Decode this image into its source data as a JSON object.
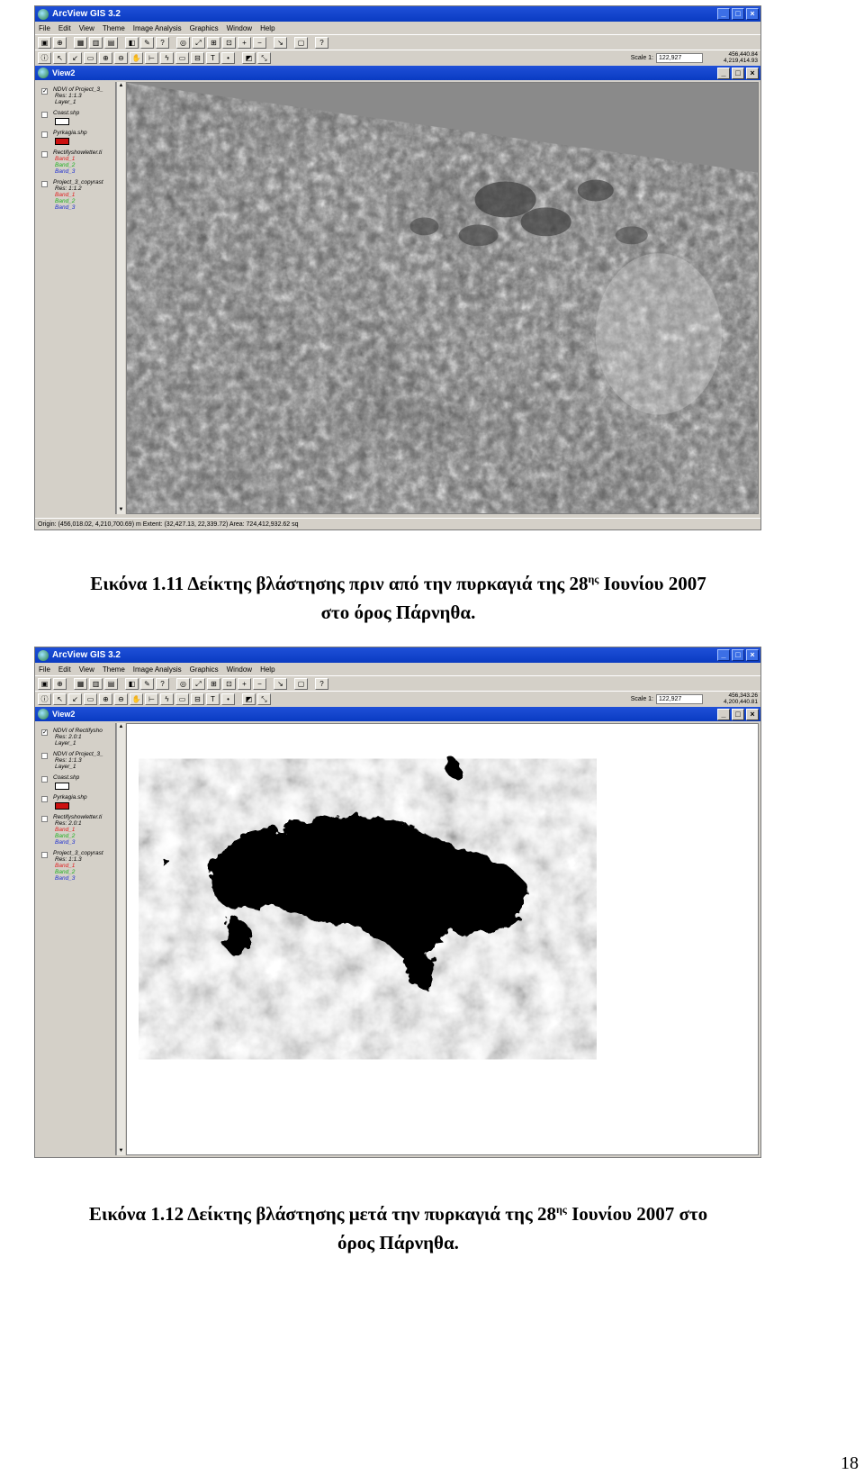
{
  "app_title": "ArcView GIS 3.2",
  "menu": [
    "File",
    "Edit",
    "View",
    "Theme",
    "Image Analysis",
    "Graphics",
    "Window",
    "Help"
  ],
  "toolbar_row1": [
    "save-icon",
    "add-theme-icon",
    "table-icon",
    "chart-icon",
    "layout-icon",
    "theme-props-icon",
    "edit-legend-icon",
    "query-icon",
    "locate-icon",
    "zoom-full-icon",
    "zoom-theme-icon",
    "zoom-select-icon",
    "zoom-in-icon",
    "zoom-out-icon",
    "select-feature-icon",
    "clear-select-icon",
    "help-icon"
  ],
  "toolbar_row2": [
    "info-icon",
    "pointer-icon",
    "vertex-icon",
    "select-icon",
    "zoom-in-tool-icon",
    "zoom-out-tool-icon",
    "pan-icon",
    "measure-icon",
    "hotlink-icon",
    "area-icon",
    "label-icon",
    "text-icon",
    "draw-icon",
    "image-tool-1-icon",
    "image-tool-2-icon"
  ],
  "scale_label": "Scale 1:",
  "view_title": "View2",
  "figure1": {
    "scale_value": "122,927",
    "coords": [
      "456,440.84",
      "4,219,414.93"
    ],
    "toc": [
      {
        "checked": true,
        "name": "NDVI of Project_3_",
        "lines": [
          "Res: 1:1.3",
          "Layer_1"
        ]
      },
      {
        "checked": false,
        "name": "Coast.shp",
        "swatch": "#ffffff"
      },
      {
        "checked": false,
        "name": "Pyrkagia.shp",
        "swatch": "#cc1010"
      },
      {
        "checked": false,
        "name": "Rectifyshowletter.ti",
        "lines": [
          "Band_1",
          "Band_2",
          "Band_3"
        ]
      },
      {
        "checked": false,
        "name": "Project_3_copyrast",
        "lines": [
          "Res: 1:1.2",
          "Band_1",
          "Band_2",
          "Band_3"
        ]
      }
    ],
    "status_text": "Origin: (456,018.02, 4,210,700.69) m  Extent: (32,427.13, 22,339.72)   Area: 724,412,932.62 sq",
    "caption_before": "Εικόνα 1.11 Δείκτης βλάστησης πριν από την πυρκαγιά της 28",
    "caption_sup": "ης",
    "caption_after": " Ιουνίου 2007",
    "caption_line2": "στο όρος Πάρνηθα."
  },
  "figure2": {
    "scale_value": "122,927",
    "coords": [
      "456,343.26",
      "4,200,440.81"
    ],
    "toc": [
      {
        "checked": true,
        "name": "NDVI of Rectifysho",
        "lines": [
          "Res: 2.0:1",
          "Layer_1"
        ]
      },
      {
        "checked": false,
        "name": "NDVI of Project_3_",
        "lines": [
          "Res: 1:1.3",
          "Layer_1"
        ]
      },
      {
        "checked": false,
        "name": "Coast.shp",
        "swatch": "#ffffff"
      },
      {
        "checked": false,
        "name": "Pyrkagia.shp",
        "swatch": "#cc1010"
      },
      {
        "checked": false,
        "name": "Rectifyshowletter.ti",
        "lines": [
          "Res: 2.0:1",
          "Band_1",
          "Band_2",
          "Band_3"
        ]
      },
      {
        "checked": false,
        "name": "Project_3_copyrast",
        "lines": [
          "Res: 1:1.3",
          "Band_1",
          "Band_2",
          "Band_3"
        ]
      }
    ],
    "caption_before": "Εικόνα 1.12 Δείκτης βλάστησης μετά την πυρκαγιά της 28",
    "caption_sup": "ης",
    "caption_after": " Ιουνίου 2007 στο",
    "caption_line2": "όρος Πάρνηθα."
  },
  "band_colors": {
    "Band_1": "#e02020",
    "Band_2": "#20b020",
    "Band_3": "#2030d0"
  },
  "page_number": "18"
}
